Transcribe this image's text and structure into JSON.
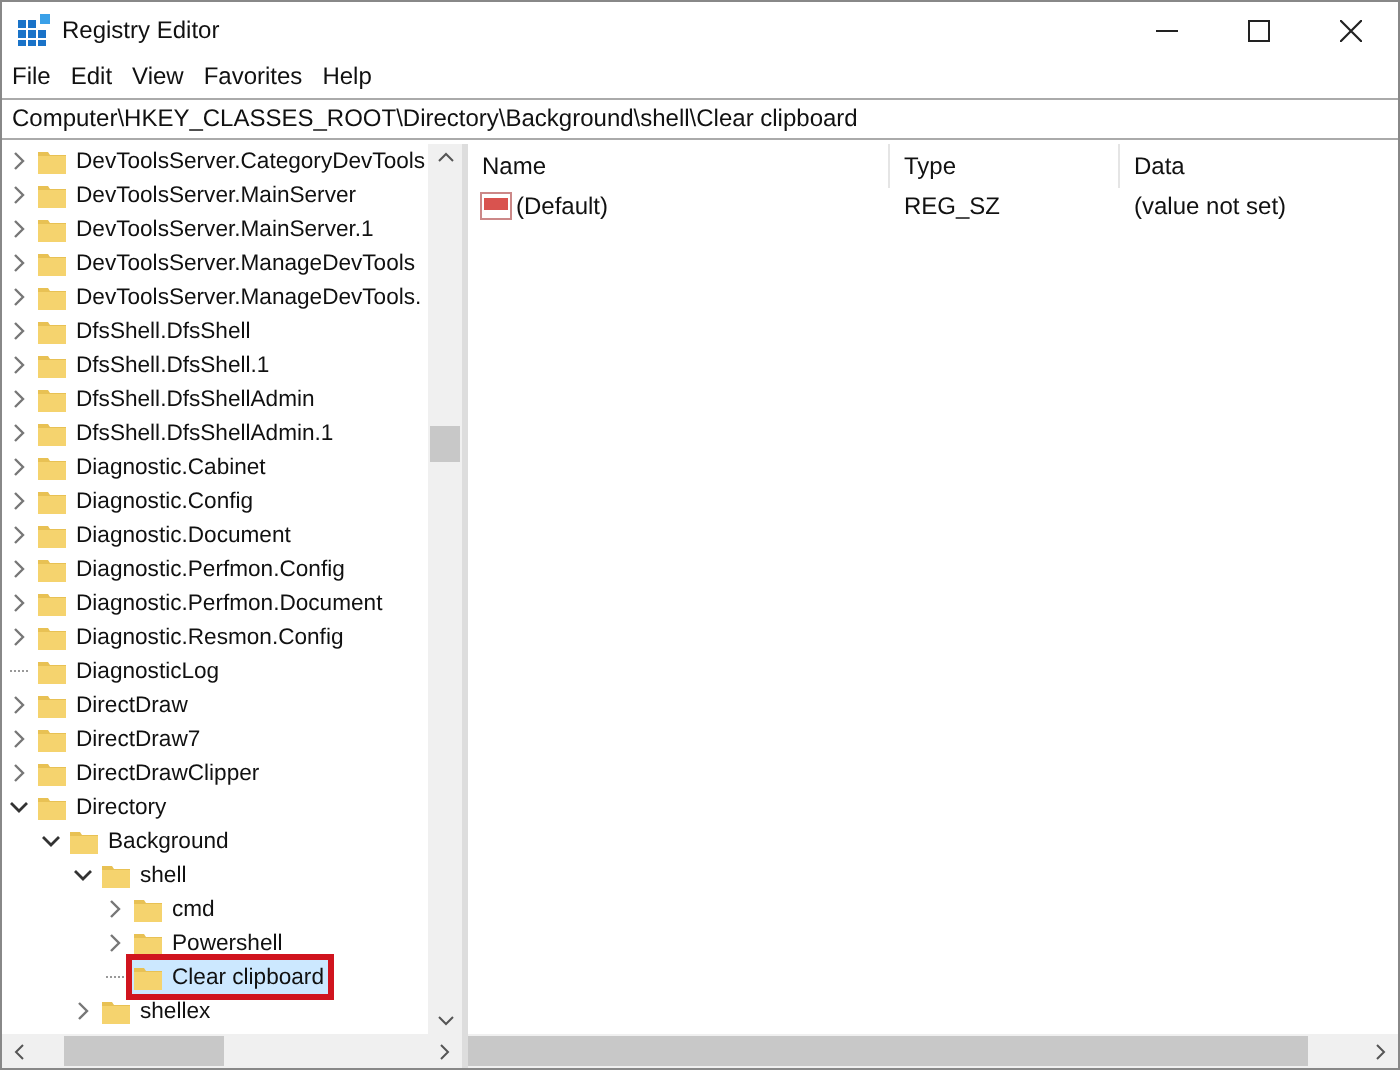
{
  "window": {
    "title": "Registry Editor"
  },
  "menu": [
    "File",
    "Edit",
    "View",
    "Favorites",
    "Help"
  ],
  "address": "Computer\\HKEY_CLASSES_ROOT\\Directory\\Background\\shell\\Clear clipboard",
  "tree": [
    {
      "label": "DevToolsServer.CategoryDevTools",
      "expanded": false,
      "selected": false
    },
    {
      "label": "DevToolsServer.MainServer",
      "expanded": false,
      "selected": false
    },
    {
      "label": "DevToolsServer.MainServer.1",
      "expanded": false,
      "selected": false
    },
    {
      "label": "DevToolsServer.ManageDevTools",
      "expanded": false,
      "selected": false
    },
    {
      "label": "DevToolsServer.ManageDevTools.",
      "expanded": false,
      "selected": false
    },
    {
      "label": "DfsShell.DfsShell",
      "expanded": false,
      "selected": false
    },
    {
      "label": "DfsShell.DfsShell.1",
      "expanded": false,
      "selected": false
    },
    {
      "label": "DfsShell.DfsShellAdmin",
      "expanded": false,
      "selected": false
    },
    {
      "label": "DfsShell.DfsShellAdmin.1",
      "expanded": false,
      "selected": false
    },
    {
      "label": "Diagnostic.Cabinet",
      "expanded": false,
      "selected": false
    },
    {
      "label": "Diagnostic.Config",
      "expanded": false,
      "selected": false
    },
    {
      "label": "Diagnostic.Document",
      "expanded": false,
      "selected": false
    },
    {
      "label": "Diagnostic.Perfmon.Config",
      "expanded": false,
      "selected": false
    },
    {
      "label": "Diagnostic.Perfmon.Document",
      "expanded": false,
      "selected": false
    },
    {
      "label": "Diagnostic.Resmon.Config",
      "expanded": false,
      "selected": false
    },
    {
      "label": "DiagnosticLog",
      "selected": false
    },
    {
      "label": "DirectDraw",
      "expanded": false,
      "selected": false
    },
    {
      "label": "DirectDraw7",
      "expanded": false,
      "selected": false
    },
    {
      "label": "DirectDrawClipper",
      "expanded": false,
      "selected": false
    },
    {
      "label": "Directory",
      "expanded": true,
      "selected": false,
      "children": [
        {
          "label": "Background",
          "expanded": true,
          "selected": false,
          "children": [
            {
              "label": "shell",
              "expanded": true,
              "selected": false,
              "children": [
                {
                  "label": "cmd",
                  "expanded": false,
                  "selected": false
                },
                {
                  "label": "Powershell",
                  "expanded": false,
                  "selected": false
                },
                {
                  "label": "Clear clipboard",
                  "selected": true
                }
              ]
            },
            {
              "label": "shellex",
              "expanded": false,
              "selected": false
            }
          ]
        }
      ]
    }
  ],
  "columns": [
    "Name",
    "Type",
    "Data"
  ],
  "values": [
    {
      "name": "(Default)",
      "type": "REG_SZ",
      "data": "(value not set)"
    }
  ]
}
